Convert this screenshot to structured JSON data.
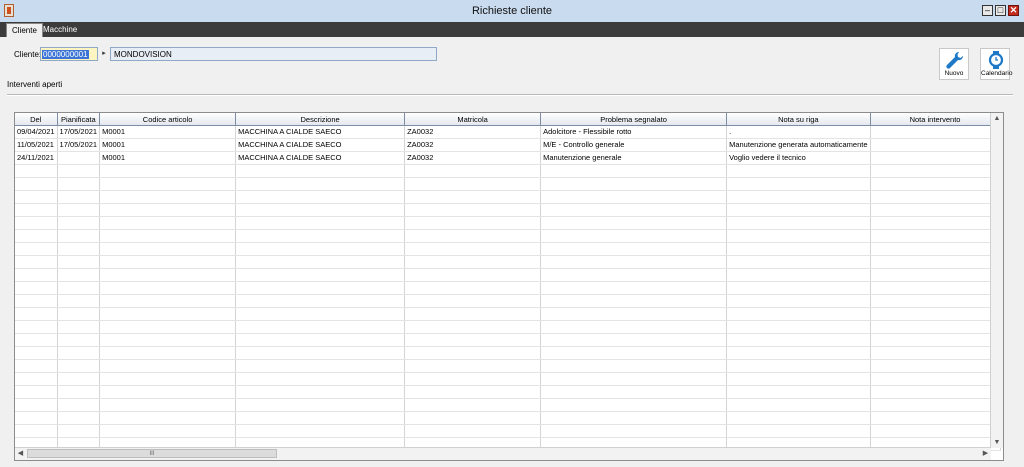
{
  "window": {
    "title": "Richieste cliente"
  },
  "tabs": [
    {
      "label": "Cliente",
      "active": true
    },
    {
      "label": "Macchine",
      "active": false
    }
  ],
  "client": {
    "label": "Cliente:",
    "code": "0000000001",
    "arrow": "▸",
    "name": "MONDOVISION"
  },
  "toolbar": {
    "new_label": "Nuovo",
    "new_icon": "wrench-icon",
    "calendar_label": "Calendario",
    "calendar_icon": "watch-icon",
    "icon_color": "#1e78c8"
  },
  "section": {
    "label": "Interventi aperti"
  },
  "grid": {
    "columns": [
      "Del",
      "Pianificata",
      "Codice articolo",
      "Descrizione",
      "Matricola",
      "Problema segnalato",
      "Nota su riga",
      "Nota intervento"
    ],
    "rows": [
      [
        "09/04/2021",
        "17/05/2021",
        "M0001",
        "MACCHINA A CIALDE SAECO",
        "ZA0032",
        "Adolcitore - Flessibile rotto",
        ".",
        ""
      ],
      [
        "11/05/2021",
        "17/05/2021",
        "M0001",
        "MACCHINA A CIALDE SAECO",
        "ZA0032",
        "M/E - Controllo generale",
        "Manutenzione generata automaticamente",
        ""
      ],
      [
        "24/11/2021",
        "",
        "M0001",
        "MACCHINA A CIALDE SAECO",
        "ZA0032",
        "Manutenzione generale",
        "Voglio vedere il tecnico",
        ""
      ]
    ],
    "hscroll_thumb": "III"
  }
}
